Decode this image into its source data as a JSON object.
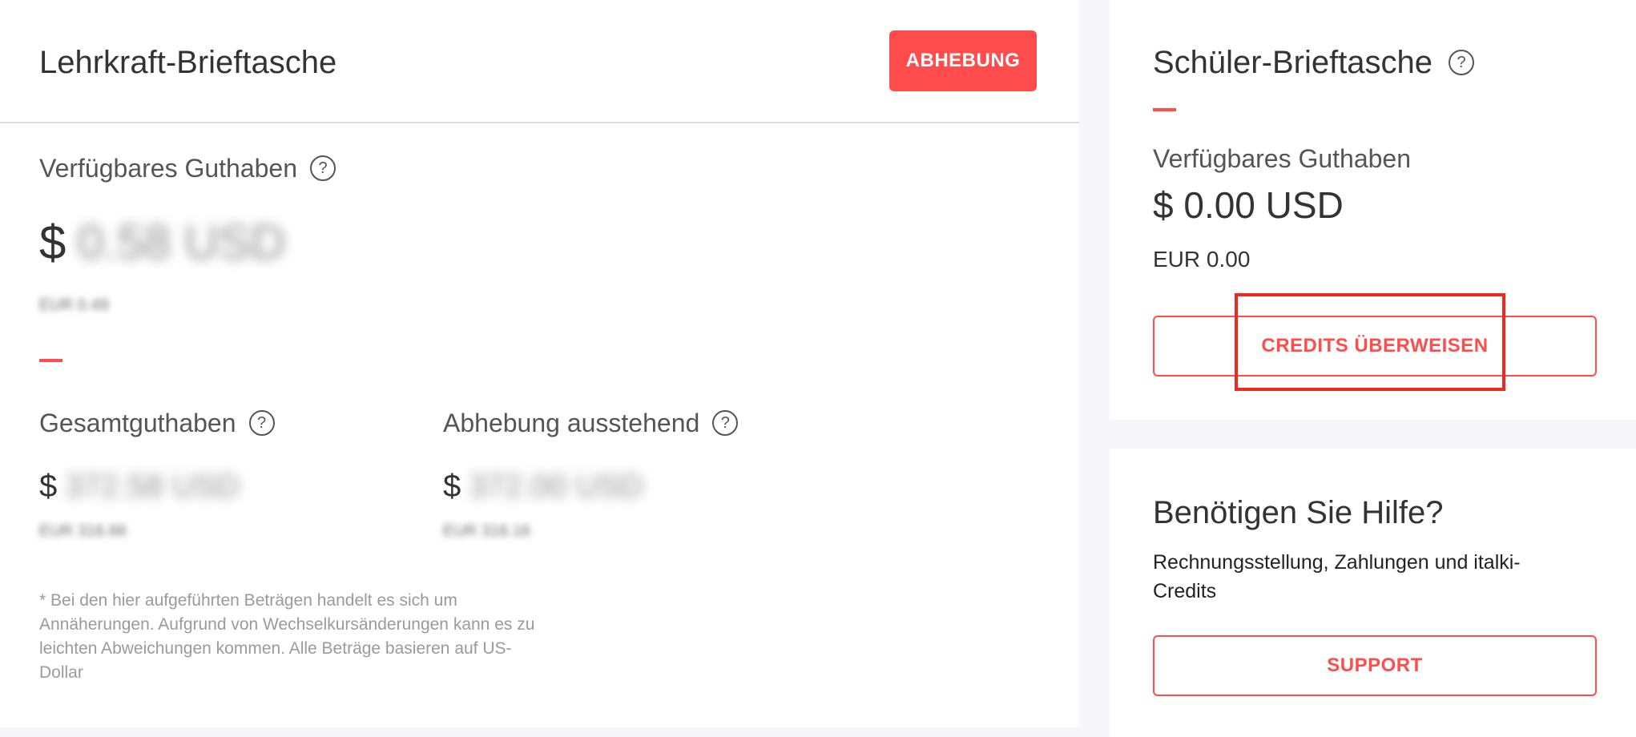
{
  "teacher_wallet": {
    "title": "Lehrkraft-Brieftasche",
    "withdraw_label": "ABHEBUNG",
    "available_label": "Verfügbares Guthaben",
    "currency_sign": "$",
    "available_amount": "0.58 USD",
    "available_eur": "EUR 0.49",
    "total_label": "Gesamtguthaben",
    "total_amount": "372.58 USD",
    "total_eur": "EUR 316.66",
    "pending_label": "Abhebung ausstehend",
    "pending_amount": "372.00 USD",
    "pending_eur": "EUR 316.16",
    "disclaimer": "* Bei den hier aufgeführten Beträgen handelt es sich um Annäherungen. Aufgrund von Wechselkursänderungen kann es zu leichten Abweichungen kommen. Alle Beträge basieren auf US-Dollar"
  },
  "student_wallet": {
    "title": "Schüler-Brieftasche",
    "available_label": "Verfügbares Guthaben",
    "amount": "$ 0.00 USD",
    "eur": "EUR 0.00",
    "transfer_label": "CREDITS ÜBERWEISEN"
  },
  "help": {
    "title": "Benötigen Sie Hilfe?",
    "text": "Rechnungsstellung, Zahlungen und italki-Credits",
    "support_label": "SUPPORT"
  },
  "icons": {
    "help_glyph": "?"
  },
  "colors": {
    "accent": "#ff4d4d",
    "highlight_box": "#ee2a1c",
    "background": "#f7f7fb"
  }
}
